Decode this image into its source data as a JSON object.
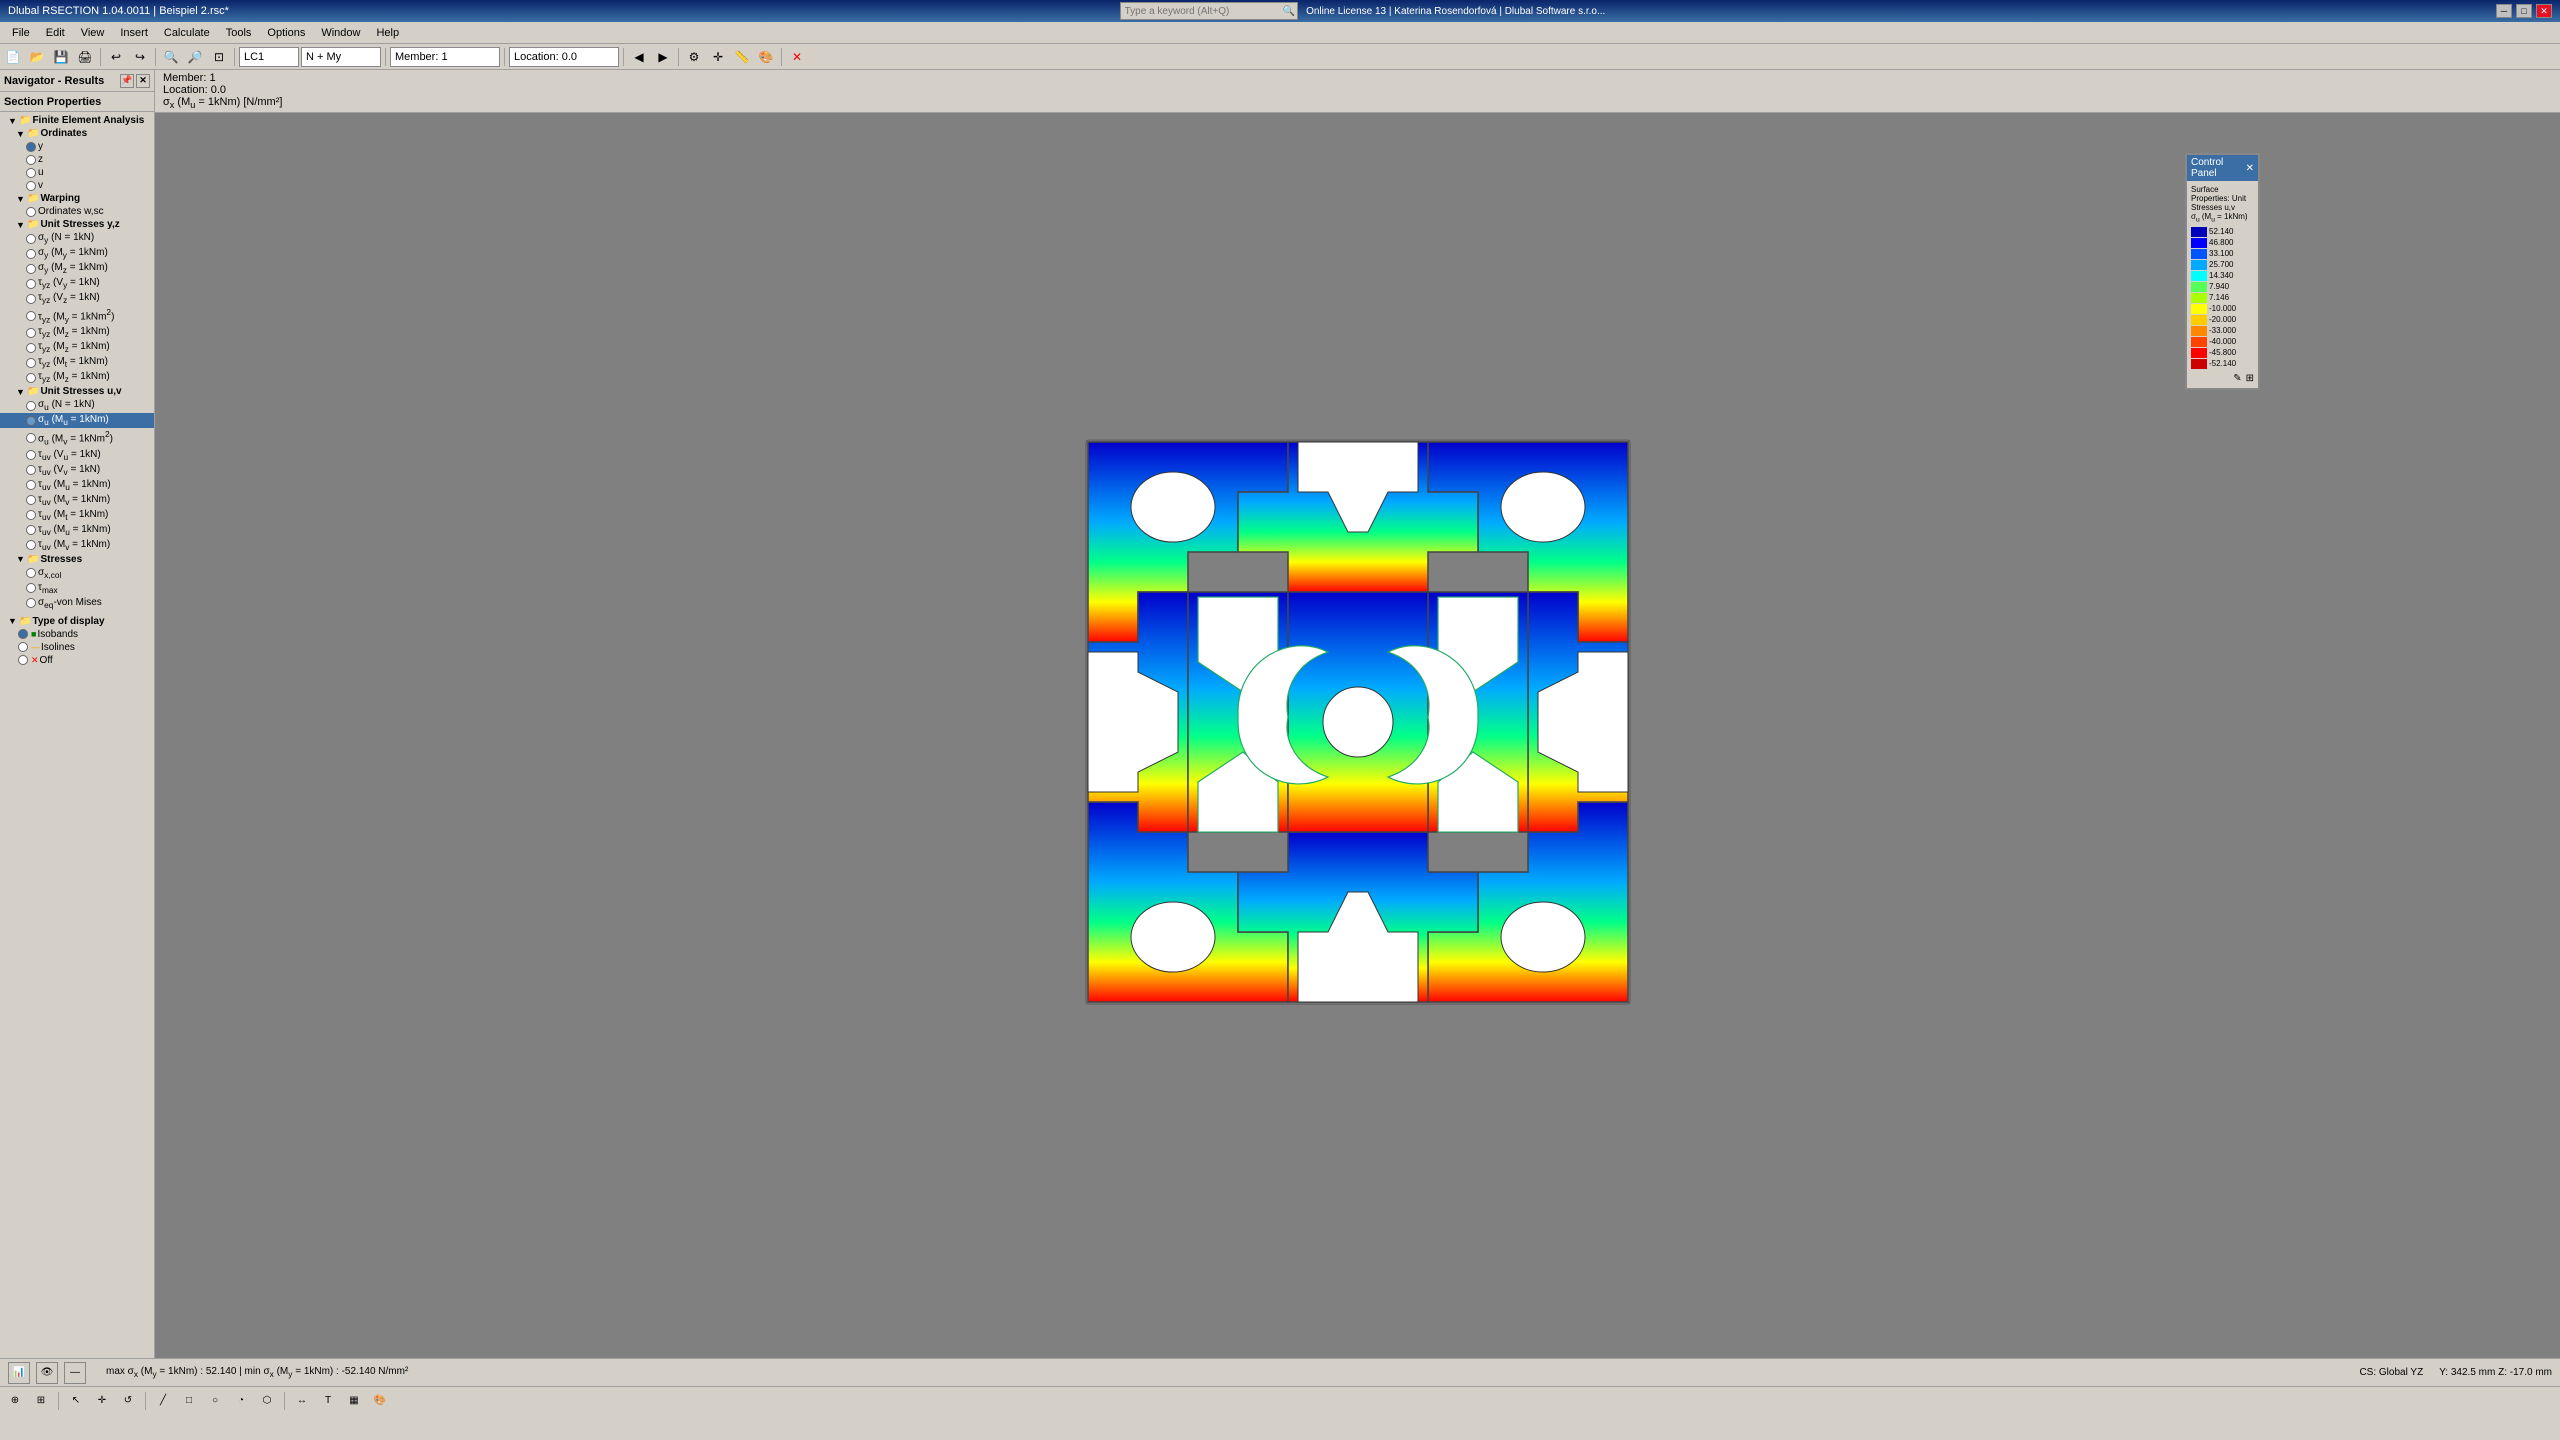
{
  "titlebar": {
    "title": "Dlubal RSECTION 1.04.0011 | Beispiel 2.rsc*",
    "search_placeholder": "Type a keyword (Alt+Q)",
    "license_info": "Online License 13 | Katerina Rosendorfová | Dlubal Software s.r.o...",
    "min_btn": "─",
    "max_btn": "□",
    "close_btn": "✕"
  },
  "menubar": {
    "items": [
      "File",
      "Edit",
      "View",
      "Insert",
      "Calculate",
      "Tools",
      "Options",
      "Window",
      "Help"
    ]
  },
  "toolbar1": {
    "lc_label": "LC1",
    "lc_value": "N + My",
    "member_label": "Member: 1",
    "location_label": "Location: 0.0"
  },
  "navigator": {
    "title": "Navigator - Results",
    "section_properties": "Section Properties",
    "finite_element": "Finite Element Analysis",
    "tree": {
      "ordinates": "Ordinates",
      "items_ordinates": [
        "y",
        "z",
        "u",
        "v"
      ],
      "warping": "Warping",
      "warping_items": [
        "Ordinates w,sc"
      ],
      "unit_stresses_yz": "Unit Stresses y,z",
      "unit_stresses_yz_items": [
        "σy (N = 1kN)",
        "σy (My = 1kNm)",
        "σy (Mz = 1kNm)",
        "τyz (Vy = 1kN)",
        "τyz (Vz = 1kN)",
        "τyz (My = 1kNm²)",
        "τyz (Mz = 1kNm)",
        "τyz (Mz = 1kNm)",
        "τyz (Mt = 1kNm)",
        "τyz (Mz = 1kNm)"
      ],
      "unit_stresses_uv": "Unit Stresses u,v",
      "unit_stresses_uv_items": [
        "σu (N = 1kN)",
        "σu (Mu = 1kNm)",
        "σu (Mv = 1kNm²)",
        "τuv (Vu = 1kN)",
        "τuv (Vv = 1kN)",
        "τuv (Mu = 1kNm)",
        "τuv (Mv = 1kNm)",
        "τuv (Mt = 1kNm)",
        "τuv (Mu = 1kNm)",
        "τuv (Mv = 1kNm)"
      ],
      "stresses": "Stresses",
      "stresses_items": [
        "σx,col",
        "τmax",
        "σeq-von Mises"
      ],
      "type_display": "Type of display",
      "display_items": [
        "Isobands",
        "Isolines",
        "Off"
      ]
    }
  },
  "info_bar": {
    "member": "Member: 1",
    "location": "Location: 0.0",
    "formula": "σx (Mu = 1kNm) [N/mm²]"
  },
  "status_bottom": {
    "formula": "max σx (My = 1kNm) : 52.140 | min σx (My = 1kNm) : -52.140 N/mm²",
    "coordinates": "CS: Global YZ",
    "position": "Y: 342.5 mm  Z: -17.0 mm"
  },
  "color_panel": {
    "title": "Control Panel",
    "subtitle": "Surface Properties: Unit Stresses u,v σu (Mu = 1kNm)",
    "scale_values": [
      {
        "value": "52.140",
        "color": "#0000cc"
      },
      {
        "value": "46.800",
        "color": "#0000ff"
      },
      {
        "value": "33.100",
        "color": "#0055ff"
      },
      {
        "value": "25.700",
        "color": "#00aaff"
      },
      {
        "value": "14.340",
        "color": "#00ffff"
      },
      {
        "value": "7.940",
        "color": "#55ff55"
      },
      {
        "value": "7.146",
        "color": "#aaff00"
      },
      {
        "value": "-10.000",
        "color": "#ffff00"
      },
      {
        "value": "-20.000",
        "color": "#ffcc00"
      },
      {
        "value": "-33.000",
        "color": "#ff8800"
      },
      {
        "value": "-40.000",
        "color": "#ff4400"
      },
      {
        "value": "-45.800",
        "color": "#ff0000"
      },
      {
        "value": "-52.140",
        "color": "#cc0000"
      }
    ]
  }
}
